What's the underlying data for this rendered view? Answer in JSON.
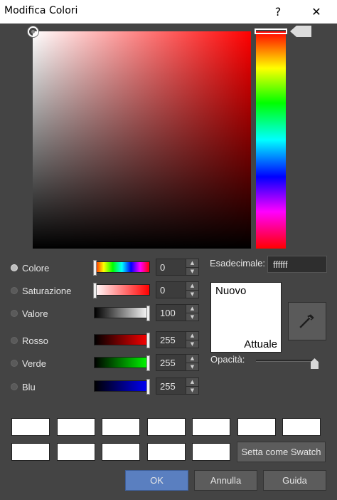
{
  "window": {
    "title": "Modifica Colori",
    "help_glyph": "?",
    "close_glyph": "✕"
  },
  "rows": [
    {
      "label": "Colore",
      "value": "0",
      "selected": true
    },
    {
      "label": "Saturazione",
      "value": "0",
      "selected": false
    },
    {
      "label": "Valore",
      "value": "100",
      "selected": false
    },
    {
      "label": "Rosso",
      "value": "255",
      "selected": false
    },
    {
      "label": "Verde",
      "value": "255",
      "selected": false
    },
    {
      "label": "Blu",
      "value": "255",
      "selected": false
    }
  ],
  "hex": {
    "label": "Esadecimale:",
    "value": "ffffff"
  },
  "preview": {
    "new_label": "Nuovo",
    "current_label": "Attuale",
    "new_color": "#ffffff",
    "current_color": "#ffffff"
  },
  "opacity": {
    "label": "Opacità:",
    "level": 1.0
  },
  "swatches": [
    "#ffffff",
    "#ffffff",
    "#ffffff",
    "#ffffff",
    "#ffffff",
    "#ffffff",
    "#ffffff",
    "#ffffff",
    "#ffffff",
    "#ffffff",
    "#ffffff",
    "#ffffff"
  ],
  "buttons": {
    "set_swatch": "Setta come Swatch",
    "ok": "OK",
    "cancel": "Annulla",
    "help": "Guida"
  },
  "colors": {
    "background": "#444444",
    "accent": "#5a7fc0",
    "hue": "#ff0000"
  }
}
